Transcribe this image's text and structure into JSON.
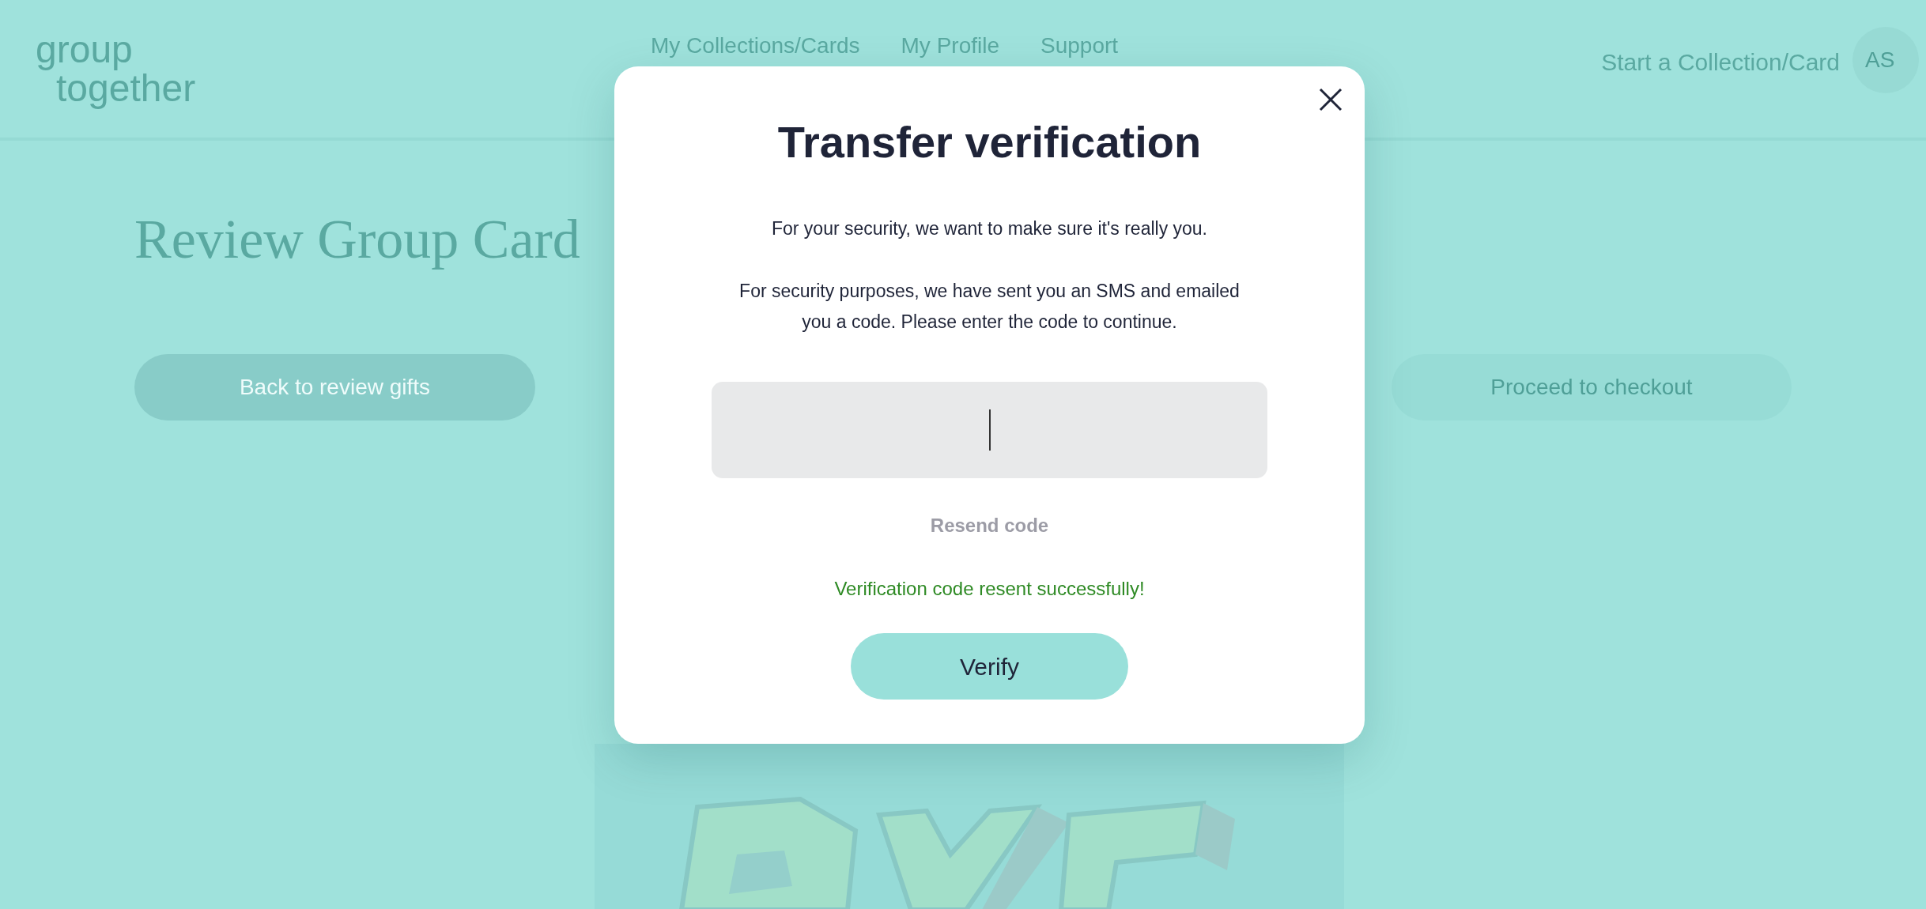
{
  "header": {
    "logo": [
      "group",
      "together"
    ],
    "nav": [
      {
        "label": "My Collections/Cards"
      },
      {
        "label": "My Profile"
      },
      {
        "label": "Support"
      }
    ],
    "start_link": "Start a Collection/Card",
    "avatar": "AS"
  },
  "page": {
    "title": "Review Group Card",
    "back_button": "Back to review gifts",
    "proceed_button": "Proceed to checkout"
  },
  "modal": {
    "title": "Transfer verification",
    "paragraphs": [
      "For your security, we want to make sure it's really you.",
      "For security purposes, we have sent you an SMS and emailed you a code. Please enter the code to continue."
    ],
    "resend_link": "Resend code",
    "success_message": "Verification code resent successfully!",
    "verify_button": "Verify"
  }
}
